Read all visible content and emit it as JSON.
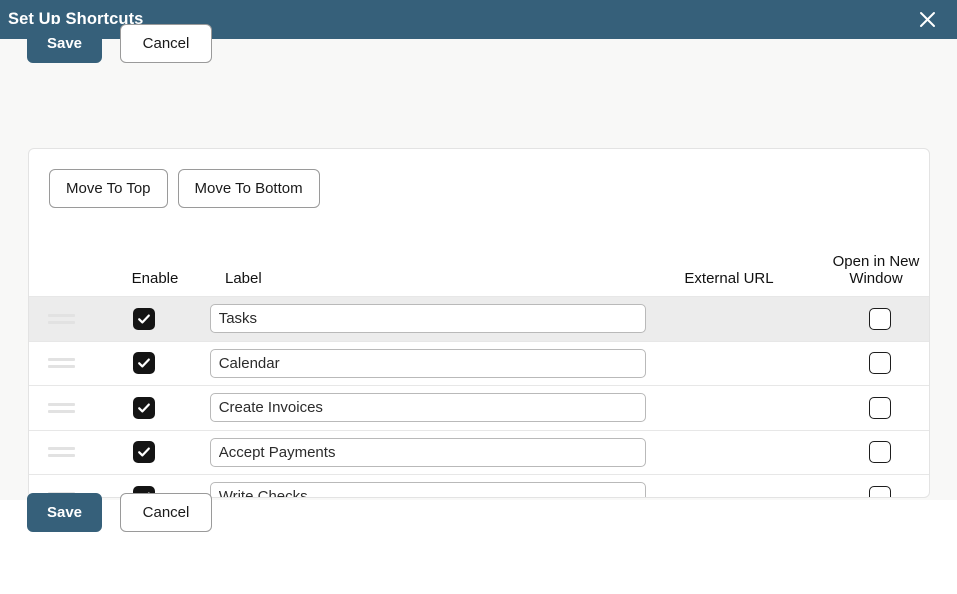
{
  "titlebar": {
    "title": "Set Up Shortcuts",
    "close_icon": "close-icon",
    "background_color": "#36607a",
    "text_color": "#ffffff"
  },
  "toolbar_top": {
    "save_label": "Save",
    "cancel_label": "Cancel"
  },
  "toolbar_bottom": {
    "save_label": "Save",
    "cancel_label": "Cancel"
  },
  "table": {
    "move_to_top_label": "Move To Top",
    "move_to_bottom_label": "Move To Bottom",
    "columns": {
      "handle": "",
      "enable": "Enable",
      "label": "Label",
      "external_url": "External URL",
      "open_in_new_window": "Open in New Window"
    },
    "rows": [
      {
        "handle_icon": "drag-handle-icon",
        "enabled": true,
        "label_value": "Tasks",
        "external_url_value": "",
        "open_in_new_window": false,
        "highlighted": true
      },
      {
        "handle_icon": "drag-handle-icon",
        "enabled": true,
        "label_value": "Calendar",
        "external_url_value": "",
        "open_in_new_window": false,
        "highlighted": false
      },
      {
        "handle_icon": "drag-handle-icon",
        "enabled": true,
        "label_value": "Create Invoices",
        "external_url_value": "",
        "open_in_new_window": false,
        "highlighted": false
      },
      {
        "handle_icon": "drag-handle-icon",
        "enabled": true,
        "label_value": "Accept Payments",
        "external_url_value": "",
        "open_in_new_window": false,
        "highlighted": false
      },
      {
        "handle_icon": "drag-handle-icon",
        "enabled": true,
        "label_value": "Write Checks",
        "external_url_value": "",
        "open_in_new_window": false,
        "highlighted": false
      }
    ]
  },
  "colors": {
    "accent": "#36607a",
    "page_background": "#f8f8f7",
    "row_highlight": "#ececec",
    "checkbox_checked": "#141414"
  }
}
